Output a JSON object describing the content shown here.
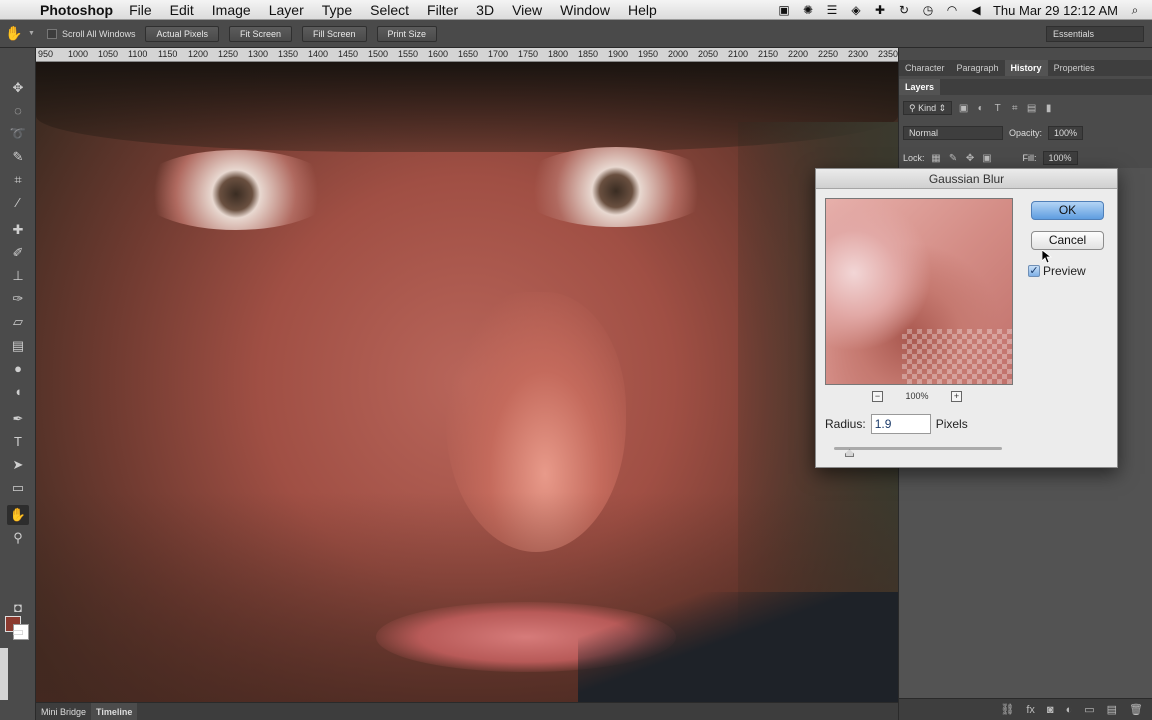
{
  "menubar": {
    "app_name": "Photoshop",
    "items": [
      "File",
      "Edit",
      "Image",
      "Layer",
      "Type",
      "Select",
      "Filter",
      "3D",
      "View",
      "Window",
      "Help"
    ],
    "datetime": "Thu Mar 29  12:12 AM"
  },
  "options_bar": {
    "scroll_all_windows": "Scroll All Windows",
    "buttons": [
      "Actual Pixels",
      "Fit Screen",
      "Fill Screen",
      "Print Size"
    ],
    "workspace": "Essentials"
  },
  "ruler": {
    "ticks": [
      "950",
      "1000",
      "1050",
      "1100",
      "1150",
      "1200",
      "1250",
      "1300",
      "1350",
      "1400",
      "1450",
      "1500",
      "1550",
      "1600",
      "1650",
      "1700",
      "1750",
      "1800",
      "1850",
      "1900",
      "1950",
      "2000",
      "2050",
      "2100",
      "2150",
      "2200",
      "2250",
      "2300",
      "2350"
    ]
  },
  "panel": {
    "tabs_top": [
      "Character",
      "Paragraph",
      "History",
      "Properties"
    ],
    "tabs_top_active": "History",
    "layers_tab": "Layers",
    "kind_label": "Kind",
    "blend_mode": "Normal",
    "opacity_label": "Opacity:",
    "opacity_value": "100%",
    "lock_label": "Lock:",
    "fill_label": "Fill:",
    "fill_value": "100%"
  },
  "bottom_tabs": [
    "Mini Bridge",
    "Timeline"
  ],
  "dialog": {
    "title": "Gaussian Blur",
    "ok_label": "OK",
    "cancel_label": "Cancel",
    "preview_label": "Preview",
    "preview_checked": true,
    "zoom_level": "100%",
    "radius_label": "Radius:",
    "radius_value": "1.9",
    "radius_unit": "Pixels"
  },
  "colors": {
    "foreground": "#8b3a2f",
    "background": "#ffffff"
  }
}
